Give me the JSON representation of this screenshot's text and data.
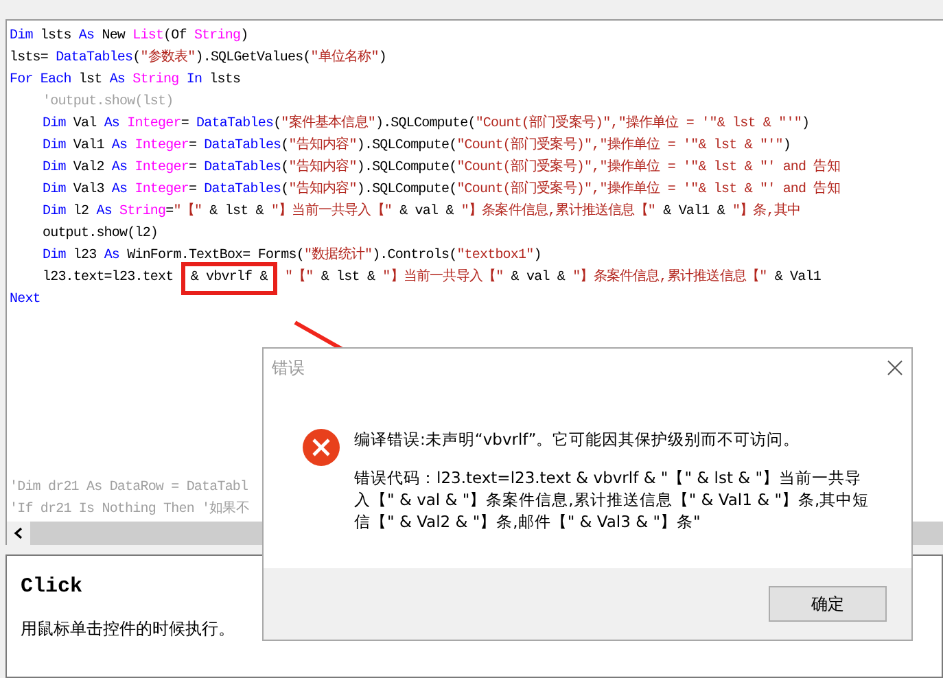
{
  "editor": {
    "lines": [
      {
        "indented": false,
        "tokens": [
          {
            "kind": "keyword",
            "text": "Dim"
          },
          {
            "kind": "plain",
            "text": " lsts "
          },
          {
            "kind": "keyword",
            "text": "As"
          },
          {
            "kind": "plain",
            "text": " New "
          },
          {
            "kind": "type",
            "text": "List"
          },
          {
            "kind": "plain",
            "text": "(Of "
          },
          {
            "kind": "type",
            "text": "String"
          },
          {
            "kind": "plain",
            "text": ")"
          }
        ]
      },
      {
        "indented": false,
        "tokens": [
          {
            "kind": "plain",
            "text": "lsts= "
          },
          {
            "kind": "keyword",
            "text": "DataTables"
          },
          {
            "kind": "plain",
            "text": "("
          },
          {
            "kind": "string",
            "text": "\"参数表\""
          },
          {
            "kind": "plain",
            "text": ").SQLGetValues("
          },
          {
            "kind": "string",
            "text": "\"单位名称\""
          },
          {
            "kind": "plain",
            "text": ")"
          }
        ]
      },
      {
        "indented": false,
        "tokens": [
          {
            "kind": "keyword",
            "text": "For Each"
          },
          {
            "kind": "plain",
            "text": " lst "
          },
          {
            "kind": "keyword",
            "text": "As"
          },
          {
            "kind": "type",
            "text": " String"
          },
          {
            "kind": "keyword",
            "text": " In"
          },
          {
            "kind": "plain",
            "text": " lsts"
          }
        ]
      },
      {
        "indented": true,
        "tokens": [
          {
            "kind": "comment",
            "text": "'output.show(lst)"
          }
        ]
      },
      {
        "indented": true,
        "tokens": [
          {
            "kind": "keyword",
            "text": "Dim"
          },
          {
            "kind": "plain",
            "text": " Val "
          },
          {
            "kind": "keyword",
            "text": "As"
          },
          {
            "kind": "type",
            "text": " Integer"
          },
          {
            "kind": "plain",
            "text": "= "
          },
          {
            "kind": "keyword",
            "text": "DataTables"
          },
          {
            "kind": "plain",
            "text": "("
          },
          {
            "kind": "string",
            "text": "\"案件基本信息\""
          },
          {
            "kind": "plain",
            "text": ").SQLCompute("
          },
          {
            "kind": "string",
            "text": "\"Count(部门受案号)\",\"操作单位 = '\"& lst & \"'\""
          },
          {
            "kind": "plain",
            "text": ")"
          }
        ]
      },
      {
        "indented": true,
        "tokens": [
          {
            "kind": "keyword",
            "text": "Dim"
          },
          {
            "kind": "plain",
            "text": " Val1 "
          },
          {
            "kind": "keyword",
            "text": "As"
          },
          {
            "kind": "type",
            "text": " Integer"
          },
          {
            "kind": "plain",
            "text": "= "
          },
          {
            "kind": "keyword",
            "text": "DataTables"
          },
          {
            "kind": "plain",
            "text": "("
          },
          {
            "kind": "string",
            "text": "\"告知内容\""
          },
          {
            "kind": "plain",
            "text": ").SQLCompute("
          },
          {
            "kind": "string",
            "text": "\"Count(部门受案号)\",\"操作单位 = '\"& lst & \"'\""
          },
          {
            "kind": "plain",
            "text": ")"
          }
        ]
      },
      {
        "indented": true,
        "tokens": [
          {
            "kind": "keyword",
            "text": "Dim"
          },
          {
            "kind": "plain",
            "text": " Val2 "
          },
          {
            "kind": "keyword",
            "text": "As"
          },
          {
            "kind": "type",
            "text": " Integer"
          },
          {
            "kind": "plain",
            "text": "= "
          },
          {
            "kind": "keyword",
            "text": "DataTables"
          },
          {
            "kind": "plain",
            "text": "("
          },
          {
            "kind": "string",
            "text": "\"告知内容\""
          },
          {
            "kind": "plain",
            "text": ").SQLCompute("
          },
          {
            "kind": "string",
            "text": "\"Count(部门受案号)\",\"操作单位 = '\"& lst & \"' and 告知"
          }
        ]
      },
      {
        "indented": true,
        "tokens": [
          {
            "kind": "keyword",
            "text": "Dim"
          },
          {
            "kind": "plain",
            "text": " Val3 "
          },
          {
            "kind": "keyword",
            "text": "As"
          },
          {
            "kind": "type",
            "text": " Integer"
          },
          {
            "kind": "plain",
            "text": "= "
          },
          {
            "kind": "keyword",
            "text": "DataTables"
          },
          {
            "kind": "plain",
            "text": "("
          },
          {
            "kind": "string",
            "text": "\"告知内容\""
          },
          {
            "kind": "plain",
            "text": ").SQLCompute("
          },
          {
            "kind": "string",
            "text": "\"Count(部门受案号)\",\"操作单位 = '\"& lst & \"' and 告知"
          }
        ]
      },
      {
        "indented": true,
        "tokens": [
          {
            "kind": "keyword",
            "text": "Dim"
          },
          {
            "kind": "plain",
            "text": " l2 "
          },
          {
            "kind": "keyword",
            "text": "As"
          },
          {
            "kind": "type",
            "text": " String"
          },
          {
            "kind": "plain",
            "text": "="
          },
          {
            "kind": "string",
            "text": "\"【\""
          },
          {
            "kind": "plain",
            "text": " & lst & "
          },
          {
            "kind": "string",
            "text": "\"】当前一共导入【\""
          },
          {
            "kind": "plain",
            "text": " & val & "
          },
          {
            "kind": "string",
            "text": "\"】条案件信息,累计推送信息【\""
          },
          {
            "kind": "plain",
            "text": " & Val1 & "
          },
          {
            "kind": "string",
            "text": "\"】条,其中"
          }
        ]
      },
      {
        "indented": true,
        "tokens": [
          {
            "kind": "plain",
            "text": "output.show(l2)"
          }
        ]
      },
      {
        "indented": true,
        "tokens": [
          {
            "kind": "keyword",
            "text": "Dim"
          },
          {
            "kind": "plain",
            "text": " l23 "
          },
          {
            "kind": "keyword",
            "text": "As"
          },
          {
            "kind": "plain",
            "text": " WinForm.TextBox= Forms("
          },
          {
            "kind": "string",
            "text": "\"数据统计\""
          },
          {
            "kind": "plain",
            "text": ").Controls("
          },
          {
            "kind": "string",
            "text": "\"textbox1\""
          },
          {
            "kind": "plain",
            "text": ")"
          }
        ]
      },
      {
        "indented": true,
        "tokens": [
          {
            "kind": "plain",
            "text": "l23.text=l23.text "
          },
          {
            "kind": "boxed",
            "text": "& vbvrlf &"
          },
          {
            "kind": "string",
            "text": " \"【\""
          },
          {
            "kind": "plain",
            "text": " & lst & "
          },
          {
            "kind": "string",
            "text": "\"】当前一共导入【\""
          },
          {
            "kind": "plain",
            "text": " & val & "
          },
          {
            "kind": "string",
            "text": "\"】条案件信息,累计推送信息【\""
          },
          {
            "kind": "plain",
            "text": " & Val1"
          }
        ]
      },
      {
        "indented": false,
        "tokens": [
          {
            "kind": "keyword",
            "text": "Next"
          }
        ]
      }
    ],
    "trailing_lines": [
      {
        "indented": false,
        "tokens": [
          {
            "kind": "comment",
            "text": "'Dim dr21 As DataRow = DataTabl"
          }
        ]
      },
      {
        "indented": false,
        "tokens": [
          {
            "kind": "comment",
            "text": "'If dr21 Is Nothing Then '如果不"
          }
        ]
      }
    ]
  },
  "help": {
    "title": "Click",
    "description": "用鼠标单击控件的时候执行。"
  },
  "dialog": {
    "title": "错误",
    "message": "编译错误:未声明“vbvrlf”。它可能因其保护级别而不可访问。",
    "detail": "错误代码：l23.text=l23.text & vbvrlf & \"【\" & lst & \"】当前一共导入【\" & val & \"】条案件信息,累计推送信息【\" & Val1 & \"】条,其中短信【\" & Val2 & \"】条,邮件【\" & Val3 & \"】条\"",
    "buttons": [
      {
        "label": "确定"
      }
    ]
  }
}
